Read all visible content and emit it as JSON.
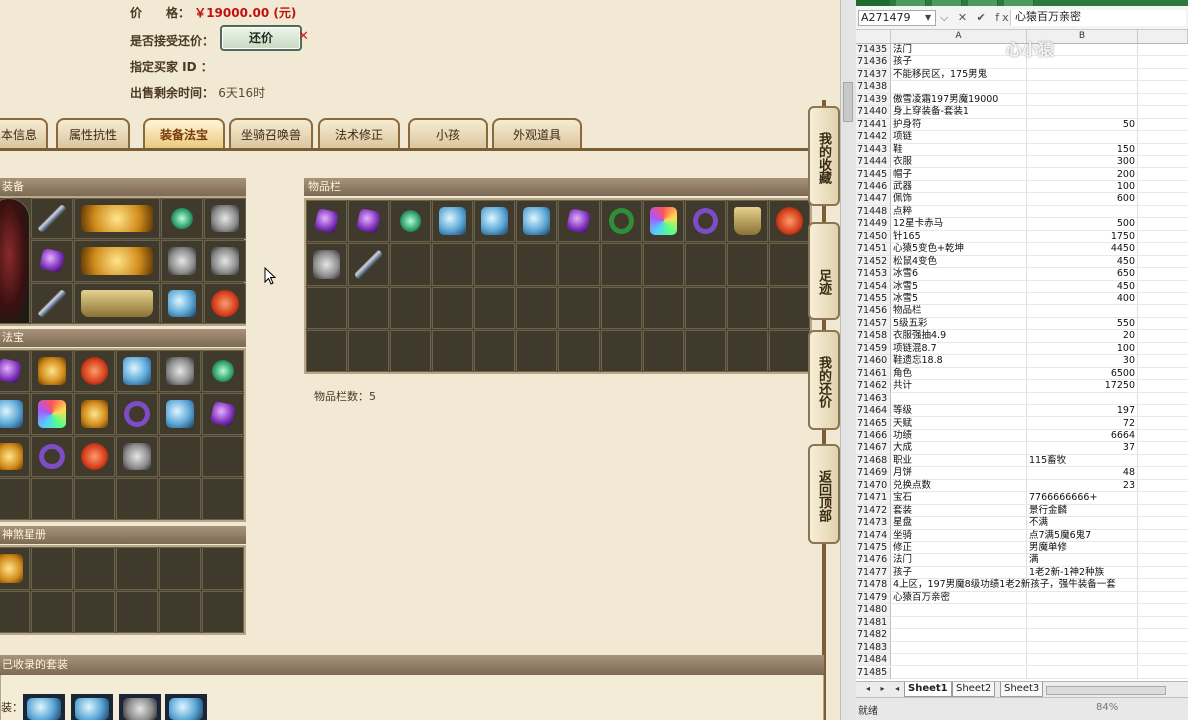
{
  "game": {
    "price_label": "价　　格：",
    "price_value": "￥19000.00 (元)",
    "accept_bargain_label": "是否接受还价：",
    "bargain_button": "还价",
    "buyer_id_label": "指定买家 ID ：",
    "remaining_label": "出售剩余时间：",
    "remaining_value": "6天16时",
    "tabs": [
      "本信息",
      "属性抗性",
      "装备法宝",
      "坐骑召唤兽",
      "法术修正",
      "小孩",
      "外观道具"
    ],
    "active_tab": "装备法宝",
    "equip_header": "装备",
    "fabao_header": "法宝",
    "inventory_header": "物品栏",
    "inventory_count": "物品栏数：5",
    "starbook_header": "神煞星册",
    "suits_header": "已收录的套装",
    "suits_label": "装：",
    "side_buttons": [
      "我的收藏",
      "足迹",
      "我的还价",
      "返回顶部"
    ]
  },
  "excel": {
    "name_box": "A271479",
    "formula_value": "心猿百万亲密",
    "formula_icons": "⌵ ✕ ✔ fx",
    "col_headers": [
      "A",
      "B"
    ],
    "watermark": "心小猿",
    "rows": [
      {
        "n": "71435",
        "a": "法门",
        "b": ""
      },
      {
        "n": "71436",
        "a": "孩子",
        "b": ""
      },
      {
        "n": "71437",
        "a": "不能移民区，175男鬼",
        "b": ""
      },
      {
        "n": "71438",
        "a": "",
        "b": ""
      },
      {
        "n": "71439",
        "a": "傲雪凌霜197男魔19000",
        "b": ""
      },
      {
        "n": "71440",
        "a": "身上穿装备-套装1",
        "b": ""
      },
      {
        "n": "71441",
        "a": "护身符",
        "b": "50"
      },
      {
        "n": "71442",
        "a": "项链",
        "b": ""
      },
      {
        "n": "71443",
        "a": "鞋",
        "b": "150"
      },
      {
        "n": "71444",
        "a": "衣服",
        "b": "300"
      },
      {
        "n": "71445",
        "a": "帽子",
        "b": "200"
      },
      {
        "n": "71446",
        "a": "武器",
        "b": "100"
      },
      {
        "n": "71447",
        "a": "佩饰",
        "b": "600"
      },
      {
        "n": "71448",
        "a": "点粹",
        "b": ""
      },
      {
        "n": "71449",
        "a": "12星卡赤马",
        "b": "500"
      },
      {
        "n": "71450",
        "a": "针165",
        "b": "1750"
      },
      {
        "n": "71451",
        "a": "心猿5变色+乾坤",
        "b": "4450"
      },
      {
        "n": "71452",
        "a": "松鼠4变色",
        "b": "450"
      },
      {
        "n": "71453",
        "a": "冰雪6",
        "b": "650"
      },
      {
        "n": "71454",
        "a": "冰雪5",
        "b": "450"
      },
      {
        "n": "71455",
        "a": "冰雪5",
        "b": "400"
      },
      {
        "n": "71456",
        "a": "物品栏",
        "b": ""
      },
      {
        "n": "71457",
        "a": "5级五彩",
        "b": "550"
      },
      {
        "n": "71458",
        "a": "衣服强抽4.9",
        "b": "20"
      },
      {
        "n": "71459",
        "a": "项链混8.7",
        "b": "100"
      },
      {
        "n": "71460",
        "a": "鞋遗忘18.8",
        "b": "30"
      },
      {
        "n": "71461",
        "a": "角色",
        "b": "6500"
      },
      {
        "n": "71462",
        "a": "共计",
        "b": "17250"
      },
      {
        "n": "71463",
        "a": "",
        "b": ""
      },
      {
        "n": "71464",
        "a": "等级",
        "b": "197"
      },
      {
        "n": "71465",
        "a": "天赋",
        "b": "72"
      },
      {
        "n": "71466",
        "a": "功绩",
        "b": "6664"
      },
      {
        "n": "71467",
        "a": "大成",
        "b": "37"
      },
      {
        "n": "71468",
        "a": "职业",
        "b": "115畜牧",
        "text": true
      },
      {
        "n": "71469",
        "a": "月饼",
        "b": "48"
      },
      {
        "n": "71470",
        "a": "兑换点数",
        "b": "23"
      },
      {
        "n": "71471",
        "a": "宝石",
        "b": "7766666666+",
        "text": true
      },
      {
        "n": "71472",
        "a": "套装",
        "b": "景行金麟",
        "text": true
      },
      {
        "n": "71473",
        "a": "星盘",
        "b": "不满",
        "text": true
      },
      {
        "n": "71474",
        "a": "坐骑",
        "b": "点7满5魔6鬼7",
        "text": true
      },
      {
        "n": "71475",
        "a": "修正",
        "b": "男魔单修",
        "text": true
      },
      {
        "n": "71476",
        "a": "法门",
        "b": "满",
        "text": true
      },
      {
        "n": "71477",
        "a": "孩子",
        "b": "1老2新-1神2种族",
        "text": true
      },
      {
        "n": "71478",
        "a": "4上区，197男魔8级功绩1老2新孩子，强牛装备一套",
        "b": ""
      },
      {
        "n": "71479",
        "a": "心猿百万亲密",
        "b": ""
      },
      {
        "n": "71480",
        "a": "",
        "b": ""
      },
      {
        "n": "71481",
        "a": "",
        "b": ""
      },
      {
        "n": "71482",
        "a": "",
        "b": ""
      },
      {
        "n": "71483",
        "a": "",
        "b": ""
      },
      {
        "n": "71484",
        "a": "",
        "b": ""
      },
      {
        "n": "71485",
        "a": "",
        "b": ""
      }
    ],
    "sheets": [
      "Sheet1",
      "Sheet2",
      "Sheet3"
    ],
    "status_left": "就绪",
    "status_zoom": "84%"
  },
  "colors": {
    "price_red": "#c01010",
    "tab_border": "#8a6a3c",
    "grid_bg": "#3f3a2b",
    "excel_green": "#2c7a3c"
  }
}
